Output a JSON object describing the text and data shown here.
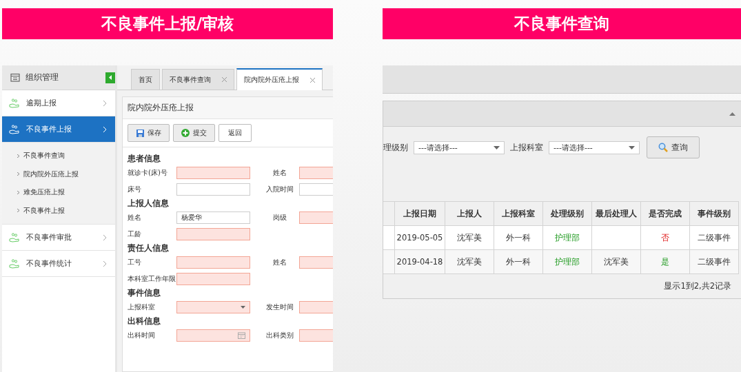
{
  "left": {
    "banner": "不良事件上报/审核",
    "sidebar": {
      "title": "组织管理",
      "items": [
        {
          "label": "逾期上报",
          "selected": false
        },
        {
          "label": "不良事件上报",
          "selected": true,
          "children": [
            {
              "label": "不良事件查询"
            },
            {
              "label": "院内院外压疮上报"
            },
            {
              "label": "难免压疮上报"
            },
            {
              "label": "不良事件上报"
            }
          ]
        },
        {
          "label": "不良事件审批",
          "selected": false
        },
        {
          "label": "不良事件统计",
          "selected": false
        }
      ]
    },
    "tabs": [
      {
        "label": "首页",
        "selected": false,
        "closable": false
      },
      {
        "label": "不良事件查询",
        "selected": false,
        "closable": true
      },
      {
        "label": "院内院外压疮上报",
        "selected": true,
        "closable": true
      }
    ],
    "form": {
      "title": "院内院外压疮上报",
      "buttons": [
        {
          "label": "保存",
          "kind": "save"
        },
        {
          "label": "提交",
          "kind": "submit"
        },
        {
          "label": "返回",
          "kind": "back"
        }
      ],
      "sections": [
        {
          "title": "患者信息",
          "rows": [
            [
              {
                "label": "就诊卡(床)号",
                "required": true,
                "kind": "text"
              },
              {
                "label": "姓名",
                "required": true,
                "kind": "text"
              }
            ],
            [
              {
                "label": "床号",
                "required": false,
                "kind": "text"
              },
              {
                "label": "入院时间",
                "required": false,
                "kind": "text"
              }
            ]
          ]
        },
        {
          "title": "上报人信息",
          "rows": [
            [
              {
                "label": "姓名",
                "required": false,
                "kind": "text",
                "value": "杨爱华"
              },
              {
                "label": "岗级",
                "required": true,
                "kind": "text"
              }
            ],
            [
              {
                "label": "工龄",
                "required": true,
                "kind": "text"
              }
            ]
          ]
        },
        {
          "title": "责任人信息",
          "rows": [
            [
              {
                "label": "工号",
                "required": true,
                "kind": "text"
              },
              {
                "label": "姓名",
                "required": true,
                "kind": "text"
              }
            ],
            [
              {
                "label": "本科室工作年限",
                "required": true,
                "kind": "text"
              }
            ]
          ]
        },
        {
          "title": "事件信息",
          "rows": [
            [
              {
                "label": "上报科室",
                "required": true,
                "kind": "select"
              },
              {
                "label": "发生时间",
                "required": true,
                "kind": "text"
              }
            ]
          ]
        },
        {
          "title": "出科信息",
          "rows": [
            [
              {
                "label": "出科时间",
                "required": true,
                "kind": "date"
              },
              {
                "label": "出科类别",
                "required": true,
                "kind": "text"
              }
            ]
          ]
        }
      ]
    }
  },
  "right": {
    "banner": "不良事件查询",
    "filters": [
      {
        "label": "理级别",
        "value": "---请选择---"
      },
      {
        "label": "上报科室",
        "value": "---请选择---"
      }
    ],
    "search_button": "查询",
    "table": {
      "columns": [
        "上报日期",
        "上报人",
        "上报科室",
        "处理级别",
        "最后处理人",
        "是否完成",
        "事件级别"
      ],
      "rows": [
        {
          "date": "2019-05-05",
          "reporter": "沈军美",
          "dept": "外一科",
          "level": "护理部",
          "done_label": "否",
          "done": false,
          "event_level": "二级事件"
        },
        {
          "date": "2019-04-18",
          "reporter": "沈军美",
          "dept": "外一科",
          "level": "护理部",
          "last_handler": "沈军美",
          "done_label": "是",
          "done": true,
          "event_level": "二级事件"
        }
      ]
    },
    "footer": "显示1到2,共2记录"
  }
}
